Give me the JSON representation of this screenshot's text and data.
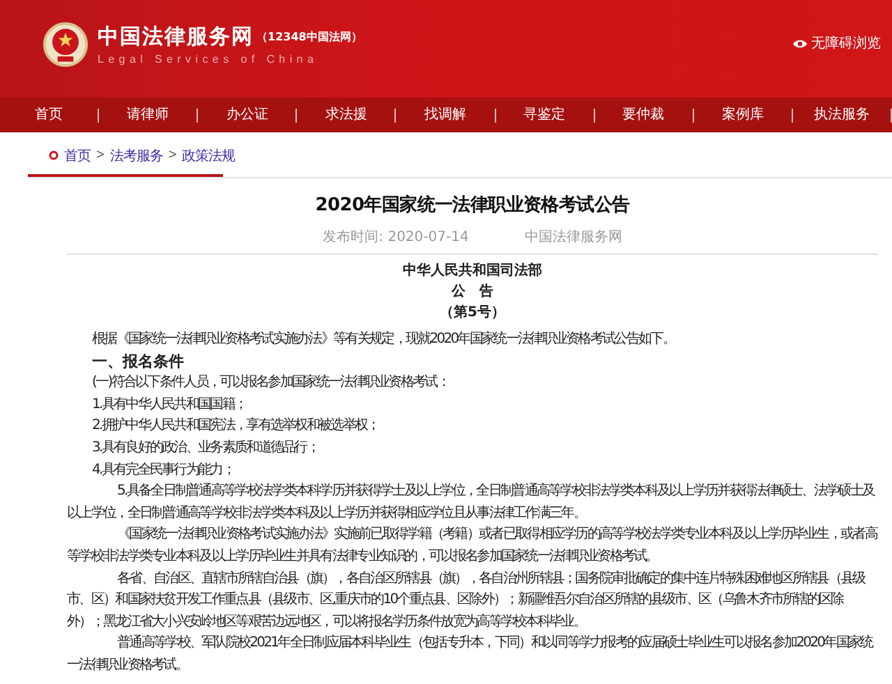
{
  "header": {
    "site_name": "中国法律服务网",
    "site_sub": "（12348中国法网）",
    "site_en": "Legal Services of China",
    "accessibility": "无障碍浏览"
  },
  "nav": [
    {
      "label": "首页"
    },
    {
      "label": "请律师"
    },
    {
      "label": "办公证"
    },
    {
      "label": "求法援"
    },
    {
      "label": "找调解"
    },
    {
      "label": "寻鉴定"
    },
    {
      "label": "要仲裁"
    },
    {
      "label": "案例库"
    },
    {
      "label": "执法服务"
    }
  ],
  "breadcrumb": {
    "separator": ">",
    "items": [
      "首页",
      "法考服务",
      "政策法规"
    ]
  },
  "article": {
    "title": "2020年国家统一法律职业资格考试公告",
    "published": "发布时间: 2020-07-14",
    "source": "中国法律服务网",
    "issuer": [
      "中华人民共和国司法部",
      "公　告",
      "（第5号）"
    ],
    "paragraphs": [
      {
        "kind": "plain",
        "text": "根据《国家统一法律职业资格考试实施办法》等有关规定，现就2020年国家统一法律职业资格考试公告如下。"
      },
      {
        "kind": "heading",
        "text": "一、报名条件"
      },
      {
        "kind": "plain",
        "text": "(一)符合以下条件人员，可以报名参加国家统一法律职业资格考试："
      },
      {
        "kind": "plain",
        "text": "1.具有中华人民共和国国籍；"
      },
      {
        "kind": "plain",
        "text": "2.拥护中华人民共和国宪法，享有选举权和被选举权；"
      },
      {
        "kind": "plain",
        "text": "3.具有良好的政治、业务素质和道德品行；"
      },
      {
        "kind": "plain",
        "text": "4.具有完全民事行为能力；"
      },
      {
        "kind": "indent",
        "text": "5.具备全日制普通高等学校法学类本科学历并获得学士及以上学位，全日制普通高等学校非法学类本科及以上学历并获得法律硕士、法学硕士及以上学位，全日制普通高等学校非法学类本科及以上学历并获得相应学位且从事法律工作满三年。"
      },
      {
        "kind": "indent",
        "text": "《国家统一法律职业资格考试实施办法》实施前已取得学籍（考籍）或者已取得相应学历的高等学校法学类专业本科及以上学历毕业生，或者高等学校非法学类专业本科及以上学历毕业生并具有法律专业知识的，可以报名参加国家统一法律职业资格考试。"
      },
      {
        "kind": "indent",
        "text": "各省、自治区、直辖市所辖自治县（旗），各自治区所辖县（旗），各自治州所辖县；国务院审批确定的集中连片特殊困难地区所辖县（县级市、区）和国家扶贫开发工作重点县（县级市、区,重庆市的10个重点县、区除外）；新疆维吾尔自治区所辖的县级市、区（乌鲁木齐市所辖的区除外）；黑龙江省大小兴安岭地区等艰苦边远地区，可以将报名学历条件放宽为高等学校本科毕业。"
      },
      {
        "kind": "indent",
        "text": "普通高等学校、军队院校2021年全日制应届本科毕业生（包括专升本，下同）和以同等学力报考的应届硕士毕业生可以报名参加2020年国家统一法律职业资格考试。"
      }
    ]
  }
}
